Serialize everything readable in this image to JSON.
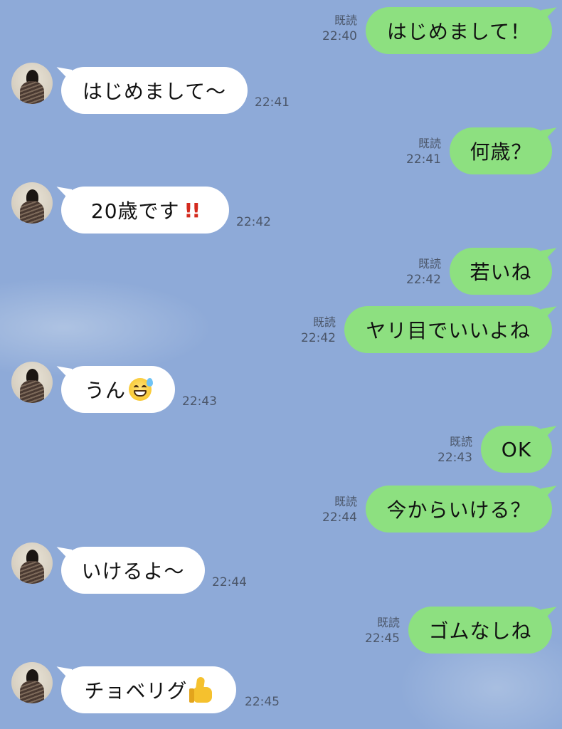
{
  "chat": {
    "read_label": "既読",
    "messages": [
      {
        "side": "out",
        "text": "はじめまして！",
        "time": "22:40"
      },
      {
        "side": "in",
        "text": "はじめまして〜",
        "time": "22:41"
      },
      {
        "side": "out",
        "text": "何歳？",
        "time": "22:41"
      },
      {
        "side": "in",
        "text": "20歳です",
        "emoji": "double-exclamation",
        "emoji_text": "!!",
        "time": "22:42"
      },
      {
        "side": "out",
        "text": "若いね",
        "time": "22:42"
      },
      {
        "side": "out",
        "text": "ヤリ目でいいよね",
        "time": "22:42"
      },
      {
        "side": "in",
        "text": "うん",
        "emoji": "grinning-sweat-face",
        "time": "22:43"
      },
      {
        "side": "out",
        "text": "OK",
        "time": "22:43"
      },
      {
        "side": "out",
        "text": "今からいける？",
        "time": "22:44"
      },
      {
        "side": "in",
        "text": "いけるよ〜",
        "time": "22:44"
      },
      {
        "side": "out",
        "text": "ゴムなしね",
        "time": "22:45"
      },
      {
        "side": "in",
        "text": "チョベリグ",
        "emoji": "thumbs-up",
        "time": "22:45"
      }
    ]
  },
  "colors": {
    "background": "#8eaad8",
    "outgoing_bubble": "#8de080",
    "incoming_bubble": "#ffffff",
    "meta_text": "#4b5669"
  }
}
